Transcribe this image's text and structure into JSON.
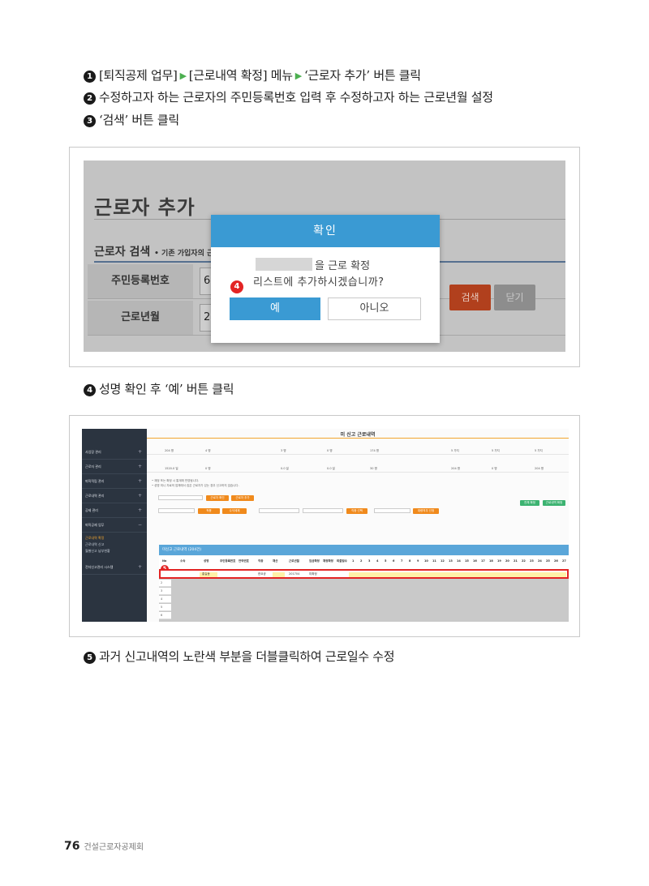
{
  "steps": {
    "s1": {
      "num": "1",
      "part1": "[퇴직공제 업무]",
      "part2": "[근로내역 확정] 메뉴",
      "part3": "‘근로자 추가’ 버튼 클릭"
    },
    "s2": {
      "num": "2",
      "text": "수정하고자 하는 근로자의 주민등록번호 입력 후 수정하고자 하는 근로년월 설정"
    },
    "s3": {
      "num": "3",
      "text": "‘검색’ 버튼 클릭"
    },
    "s4": {
      "num": "4",
      "text": "성명 확인 후 ‘예’ 버튼 클릭"
    },
    "s5": {
      "num": "5",
      "text": "과거 신고내역의 노란색 부분을 더블클릭하여 근로일수 수정"
    }
  },
  "shot1": {
    "title": "근로자 추가",
    "search_title": "근로자 검색",
    "search_sub": "• 기존 가입자의 근",
    "label_ssn": "주민등록번호",
    "value_ssn": "6",
    "label_month": "근로년월",
    "value_month": "2",
    "search_button": "검색",
    "close_button": "닫기",
    "modal": {
      "title": "확인",
      "line1": "을 근로 확정",
      "line2": "리스트에 추가하시겠습니까?",
      "yes": "예",
      "no": "아니오"
    },
    "badge": "4"
  },
  "shot2": {
    "title": "미 신고 근로내역",
    "sidebar": [
      "사업장 관리",
      "근로자 관리",
      "퇴직적립 관리",
      "근로내역 관리",
      "공제 관리",
      "퇴직공제 업무",
      "전자신고관리 시스템"
    ],
    "sidebar_sub": [
      "근로내역 확정",
      "근로내역 신고",
      "월별신고 납부현황"
    ],
    "stats_row1": [
      "204 명",
      "4 명",
      "3 명",
      "0 명",
      "174 명",
      "5 가지",
      "5 가지",
      "5 가지"
    ],
    "stats_row2": [
      "1520.0 일",
      "0 명",
      "0.0 일",
      "0.0 일",
      "30 명",
      "204 명",
      "0 명",
      "204 명"
    ],
    "note1": "• 재정 또는 확정 시 통계에 반영됩니다.",
    "note2": "• 성명 미니 자료의 업체에서 집은 근로자가 있는 경우 신고하지 않습니다.",
    "buttons": {
      "add_worker": "근로자 추가",
      "worker_confirm": "근로자 확인",
      "confirm_all": "전체 확정",
      "confirm_list": "근로내역 확정",
      "apply": "적용",
      "select_edit": "수석세제",
      "confirm_select": "직종 선택",
      "bulk": "대량의무 선정"
    },
    "grid_title": "미신고 근로내역 (204건)",
    "columns": [
      "No",
      "소속",
      "성명",
      "주민등록번호",
      "연락번호",
      "직종",
      "재산",
      "근로년월",
      "임금확정",
      "재정확정",
      "퇴출일수",
      "1",
      "2",
      "3",
      "4",
      "5",
      "6",
      "7",
      "8",
      "9",
      "10",
      "11",
      "12",
      "13",
      "14",
      "15",
      "16",
      "17",
      "18",
      "19",
      "20",
      "21",
      "22",
      "23",
      "24",
      "25",
      "26",
      "27"
    ],
    "row": {
      "name": "홍길동",
      "job": "한요공",
      "month": "201704",
      "status": "미확정"
    },
    "row_numbers": [
      "2",
      "3",
      "4",
      "5",
      "6"
    ],
    "badge": "5"
  },
  "footer": {
    "page": "76",
    "org": "건설근로자공제회"
  }
}
